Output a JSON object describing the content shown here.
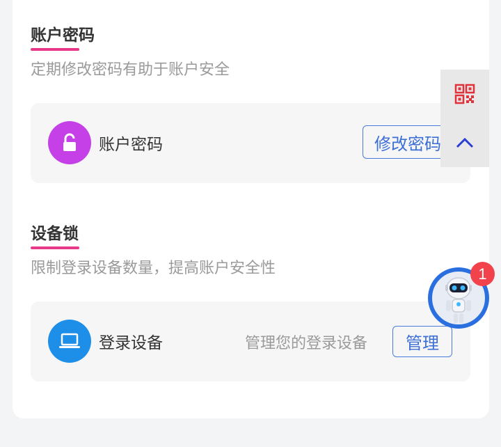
{
  "colors": {
    "accent_underline": "#e8388a",
    "lock_icon_bg": "#c640e8",
    "device_icon_bg": "#1e8fe8",
    "button_border": "#4a7bd8",
    "badge": "#f2424b",
    "qr_icon": "#e0323a",
    "chevron": "#2a3ed6"
  },
  "password_section": {
    "title": "账户密码",
    "description": "定期修改密码有助于账户安全",
    "row": {
      "icon": "unlock-icon",
      "label": "账户密码",
      "button_label": "修改密码"
    }
  },
  "device_lock_section": {
    "title": "设备锁",
    "description": "限制登录设备数量，提高账户安全性",
    "row": {
      "icon": "laptop-icon",
      "label": "登录设备",
      "hint": "管理您的登录设备",
      "button_label": "管理"
    }
  },
  "side_panel": {
    "qr_icon": "qr-code-icon",
    "up_icon": "chevron-up-icon"
  },
  "assistant": {
    "icon": "robot-avatar",
    "badge_count": "1"
  }
}
